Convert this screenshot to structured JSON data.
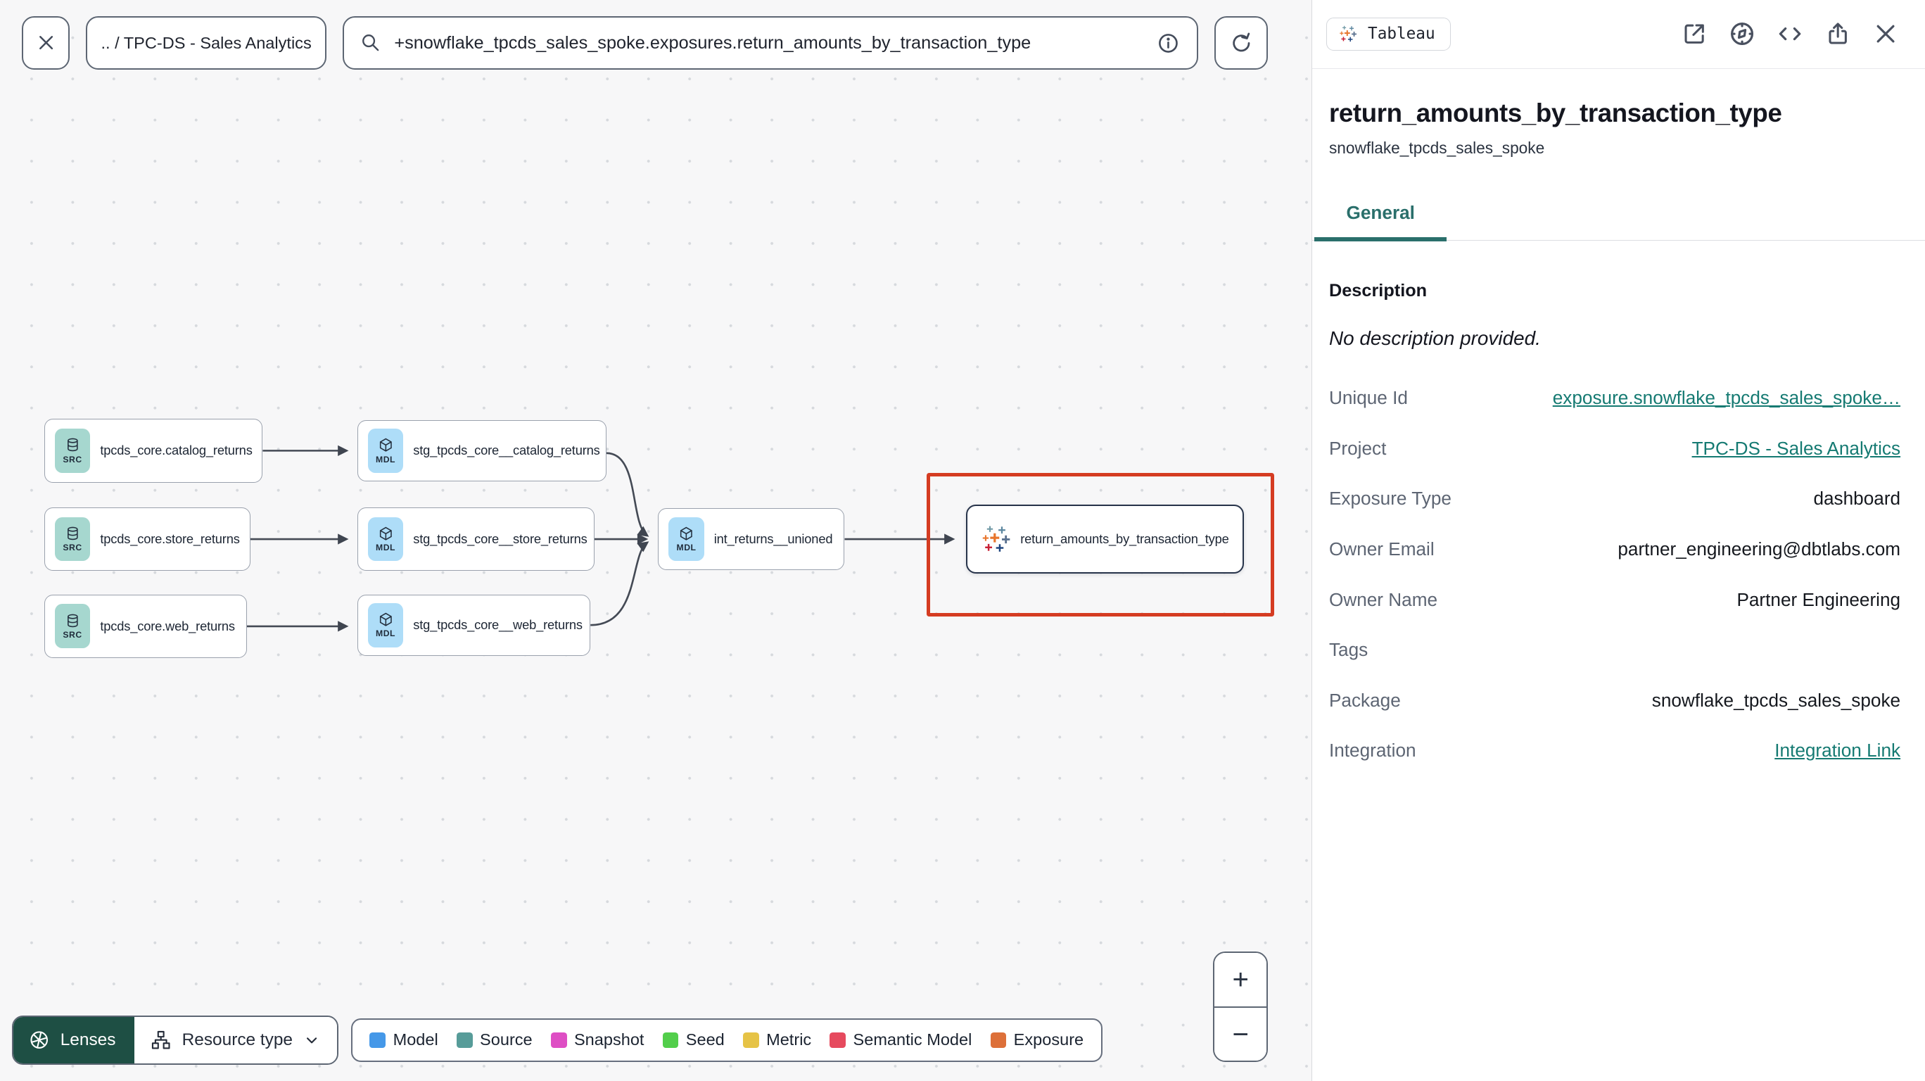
{
  "topbar": {
    "breadcrumb": ".. / TPC-DS - Sales Analytics",
    "search_value": "+snowflake_tpcds_sales_spoke.exposures.return_amounts_by_transaction_type"
  },
  "graph": {
    "nodes": [
      {
        "type": "source",
        "badge": "SRC",
        "label": "tpcds_core.catalog_returns"
      },
      {
        "type": "source",
        "badge": "SRC",
        "label": "tpcds_core.store_returns"
      },
      {
        "type": "source",
        "badge": "SRC",
        "label": "tpcds_core.web_returns"
      },
      {
        "type": "model",
        "badge": "MDL",
        "label": "stg_tpcds_core__catalog_returns"
      },
      {
        "type": "model",
        "badge": "MDL",
        "label": "stg_tpcds_core__store_returns"
      },
      {
        "type": "model",
        "badge": "MDL",
        "label": "stg_tpcds_core__web_returns"
      },
      {
        "type": "model",
        "badge": "MDL",
        "label": "int_returns__unioned"
      },
      {
        "type": "exposure",
        "badge": "",
        "label": "return_amounts_by_transaction_type"
      }
    ]
  },
  "controls": {
    "lenses_label": "Lenses",
    "resource_type_label": "Resource type"
  },
  "legend": {
    "items": [
      {
        "label": "Model",
        "color": "#4598e8"
      },
      {
        "label": "Source",
        "color": "#579c99"
      },
      {
        "label": "Snapshot",
        "color": "#de4ec4"
      },
      {
        "label": "Seed",
        "color": "#52ce4b"
      },
      {
        "label": "Metric",
        "color": "#e6c346"
      },
      {
        "label": "Semantic Model",
        "color": "#e64a5e"
      },
      {
        "label": "Exposure",
        "color": "#dd7039"
      }
    ]
  },
  "zoom_controls": {
    "zoom_in": "+",
    "zoom_out": "−"
  },
  "panel": {
    "integration_chip": "Tableau",
    "title": "return_amounts_by_transaction_type",
    "subtitle": "snowflake_tpcds_sales_spoke",
    "tabs": [
      {
        "label": "General",
        "active": true
      }
    ],
    "description_label": "Description",
    "description_value": "No description provided.",
    "fields": [
      {
        "label": "Unique Id",
        "value": "exposure.snowflake_tpcds_sales_spoke…",
        "link": true
      },
      {
        "label": "Project",
        "value": "TPC-DS - Sales Analytics",
        "link": true
      },
      {
        "label": "Exposure Type",
        "value": "dashboard",
        "link": false
      },
      {
        "label": "Owner Email",
        "value": "partner_engineering@dbtlabs.com",
        "link": false
      },
      {
        "label": "Owner Name",
        "value": "Partner Engineering",
        "link": false
      },
      {
        "label": "Tags",
        "value": "",
        "link": false
      },
      {
        "label": "Package",
        "value": "snowflake_tpcds_sales_spoke",
        "link": false
      },
      {
        "label": "Integration",
        "value": "Integration Link",
        "link": true
      }
    ]
  },
  "colors": {
    "accent_teal": "#2a6f6b",
    "link_teal": "#157a72",
    "selection_highlight_red": "#d53c22",
    "source_badge": "#a6d7cf",
    "model_badge": "#aeddf8",
    "lenses_green": "#1e4f44"
  }
}
